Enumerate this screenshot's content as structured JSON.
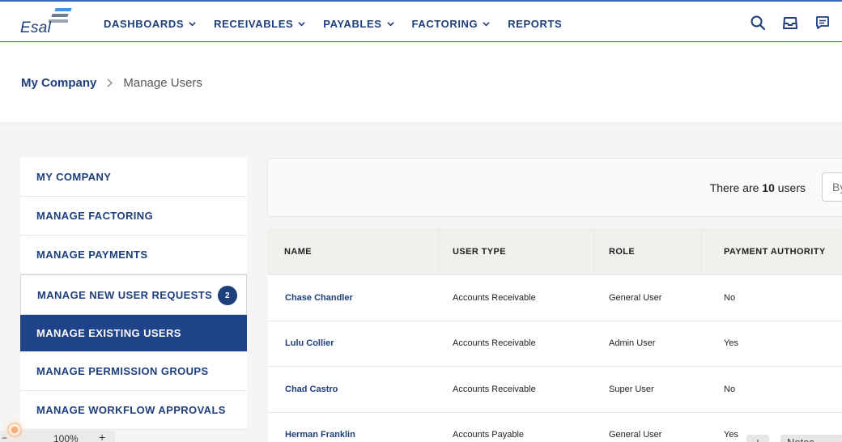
{
  "header": {
    "logo_text": "Esal",
    "nav": [
      {
        "label": "DASHBOARDS",
        "has_dropdown": true
      },
      {
        "label": "RECEIVABLES",
        "has_dropdown": true
      },
      {
        "label": "PAYABLES",
        "has_dropdown": true
      },
      {
        "label": "FACTORING",
        "has_dropdown": true
      },
      {
        "label": "REPORTS",
        "has_dropdown": false
      }
    ],
    "icons": [
      "search-icon",
      "inbox-icon",
      "chat-icon"
    ]
  },
  "breadcrumb": {
    "parent": "My Company",
    "current": "Manage Users"
  },
  "sidebar": {
    "items": [
      {
        "label": "MY COMPANY"
      },
      {
        "label": "MANAGE FACTORING"
      },
      {
        "label": "MANAGE PAYMENTS"
      },
      {
        "label": "MANAGE NEW USER REQUESTS",
        "badge": "2"
      },
      {
        "label": "MANAGE EXISTING USERS",
        "active": true
      },
      {
        "label": "MANAGE PERMISSION GROUPS"
      },
      {
        "label": "MANAGE WORKFLOW APPROVALS"
      }
    ]
  },
  "users": {
    "count_prefix": "There are",
    "count": "10",
    "count_suffix": "users",
    "search_placeholder": "By",
    "columns": [
      "NAME",
      "USER TYPE",
      "ROLE",
      "PAYMENT AUTHORITY"
    ],
    "rows": [
      {
        "name": "Chase Chandler",
        "user_type": "Accounts Receivable",
        "role": "General User",
        "payment_authority": "No"
      },
      {
        "name": "Lulu Collier",
        "user_type": "Accounts Receivable",
        "role": "Admin User",
        "payment_authority": "Yes"
      },
      {
        "name": "Chad Castro",
        "user_type": "Accounts Receivable",
        "role": "Super User",
        "payment_authority": "No"
      },
      {
        "name": "Herman Franklin",
        "user_type": "Accounts Payable",
        "role": "General User",
        "payment_authority": "Yes",
        "plus_label": "+",
        "notes_label": "Notes"
      }
    ]
  },
  "zoom": {
    "minus_label": "−",
    "level": "100%",
    "plus_label": "+"
  },
  "colors": {
    "brand_navy": "#1e3f7c",
    "active_bg": "#1e4389",
    "accent_blue": "#3b6db5"
  }
}
